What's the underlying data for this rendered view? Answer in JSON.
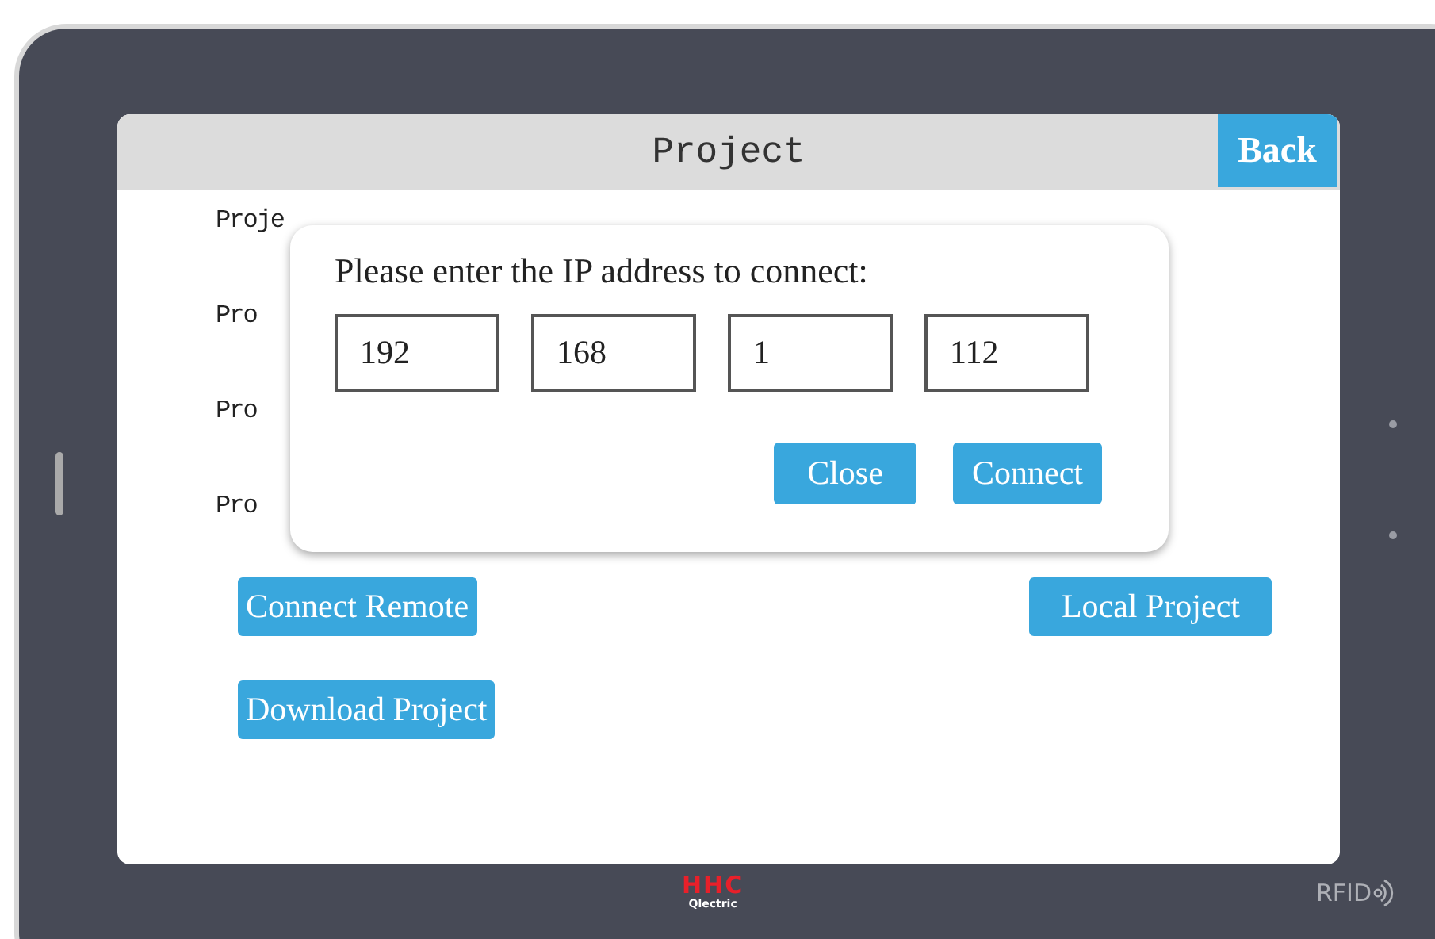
{
  "screen": {
    "title": "Project",
    "back_button": "Back",
    "info_lines": [
      "Proje",
      "Pro",
      "Pro",
      "Pro"
    ],
    "buttons": [
      {
        "label": "Connect Remote",
        "kind": "left"
      },
      {
        "label": "Local Project",
        "kind": "right"
      },
      {
        "label": "Download Project",
        "kind": "left"
      }
    ]
  },
  "dialog": {
    "prompt": "Please enter the IP address to connect:",
    "ip_fields": [
      "192",
      "168",
      "1",
      "112"
    ],
    "buttons": [
      "Close",
      "Connect"
    ]
  },
  "device": {
    "logo": "HHC",
    "logo_subtext": "Qlectric",
    "rfid_label": "RFID"
  }
}
